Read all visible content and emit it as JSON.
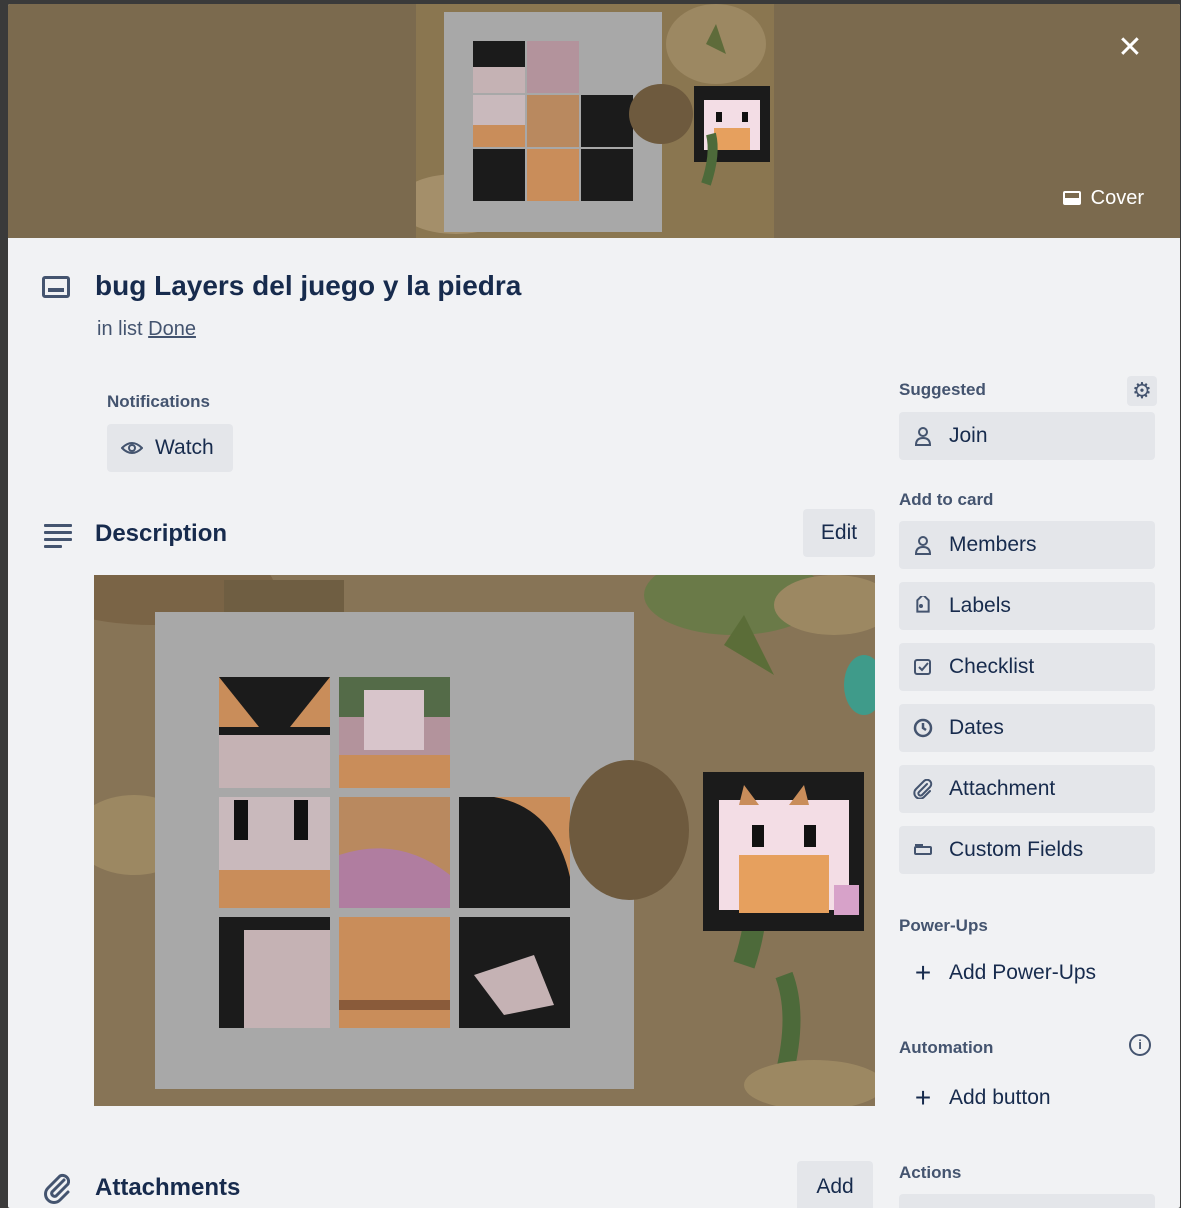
{
  "header": {
    "close_label": "✕",
    "cover_label": "Cover"
  },
  "card": {
    "title": "bug Layers del juego y la piedra",
    "in_list_prefix": "in list",
    "list_name": "Done"
  },
  "notifications": {
    "label": "Notifications",
    "watch_label": "Watch"
  },
  "description": {
    "title": "Description",
    "edit_label": "Edit"
  },
  "attachments": {
    "title": "Attachments",
    "add_label": "Add"
  },
  "sidebar": {
    "suggested_label": "Suggested",
    "join_label": "Join",
    "add_to_card_label": "Add to card",
    "add_to_card_items": [
      {
        "label": "Members",
        "icon": "person-icon"
      },
      {
        "label": "Labels",
        "icon": "label-icon"
      },
      {
        "label": "Checklist",
        "icon": "checklist-icon"
      },
      {
        "label": "Dates",
        "icon": "clock-icon"
      },
      {
        "label": "Attachment",
        "icon": "paperclip-icon"
      },
      {
        "label": "Custom Fields",
        "icon": "custom-fields-icon"
      }
    ],
    "powerups_label": "Power-Ups",
    "add_powerups_label": "Add Power-Ups",
    "automation_label": "Automation",
    "add_button_label": "Add button",
    "actions_label": "Actions"
  },
  "colors": {
    "cover_bg": "#7b6a4e",
    "panel_bg": "#f1f2f4",
    "button_bg": "#e4e6ea",
    "text": "#172b4d",
    "subtle_text": "#44546f"
  }
}
